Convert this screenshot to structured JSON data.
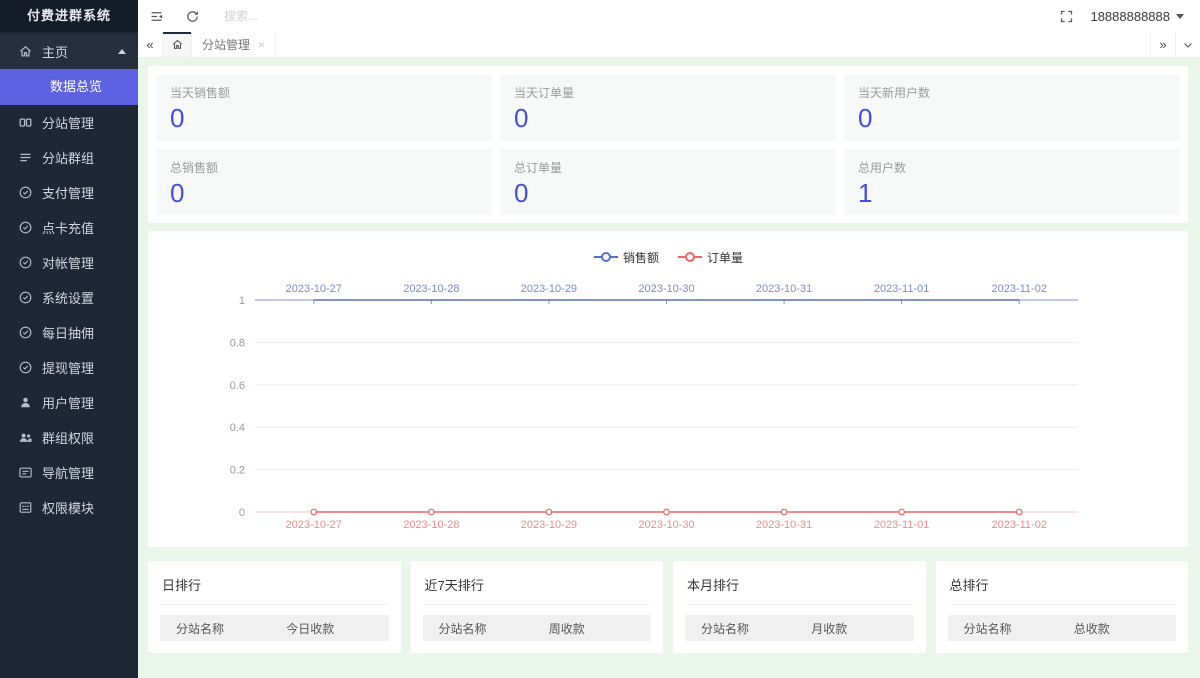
{
  "app": {
    "title": "付费进群系统",
    "user_phone": "18888888888"
  },
  "topbar": {
    "search_placeholder": "搜索..."
  },
  "tabs": {
    "items": [
      {
        "label": "分站管理"
      }
    ]
  },
  "sidebar": {
    "items": [
      {
        "label": "主页",
        "icon": "home-icon",
        "expanded": true,
        "children": [
          {
            "label": "数据总览",
            "active": true
          }
        ]
      },
      {
        "label": "分站管理",
        "icon": "component-icon"
      },
      {
        "label": "分站群组",
        "icon": "rows-icon"
      },
      {
        "label": "支付管理",
        "icon": "check-circle-icon"
      },
      {
        "label": "点卡充值",
        "icon": "check-circle-icon"
      },
      {
        "label": "对帐管理",
        "icon": "check-circle-icon"
      },
      {
        "label": "系统设置",
        "icon": "check-circle-icon"
      },
      {
        "label": "每日抽佣",
        "icon": "check-circle-icon"
      },
      {
        "label": "提现管理",
        "icon": "check-circle-icon"
      },
      {
        "label": "用户管理",
        "icon": "user-icon"
      },
      {
        "label": "群组权限",
        "icon": "users-icon"
      },
      {
        "label": "导航管理",
        "icon": "nav-icon"
      },
      {
        "label": "权限模块",
        "icon": "module-icon"
      }
    ]
  },
  "stats": {
    "cards": [
      {
        "label": "当天销售额",
        "value": "0"
      },
      {
        "label": "当天订单量",
        "value": "0"
      },
      {
        "label": "当天新用户数",
        "value": "0"
      },
      {
        "label": "总销售额",
        "value": "0"
      },
      {
        "label": "总订单量",
        "value": "0"
      },
      {
        "label": "总用户数",
        "value": "1"
      }
    ]
  },
  "chart_data": {
    "type": "line",
    "x": [
      "2023-10-27",
      "2023-10-28",
      "2023-10-29",
      "2023-10-30",
      "2023-10-31",
      "2023-11-01",
      "2023-11-02"
    ],
    "series": [
      {
        "name": "销售额",
        "color": "#5470c6",
        "values": [
          0,
          0,
          0,
          0,
          0,
          0,
          0
        ],
        "axis": "top",
        "symbol": "none"
      },
      {
        "name": "订单量",
        "color": "#ee6666",
        "values": [
          0,
          0,
          0,
          0,
          0,
          0,
          0
        ],
        "axis": "bottom",
        "symbol": "circle"
      }
    ],
    "yticks": [
      1,
      0.8,
      0.6,
      0.4,
      0.2,
      0
    ],
    "ylim": [
      0,
      1
    ],
    "legend_position": "top-center",
    "grid": true,
    "label_colors": {
      "top_axis": "#7b8bd5",
      "bottom_axis": "#ee8c8c",
      "ytick": "#999999"
    }
  },
  "rankings": [
    {
      "title": "日排行",
      "columns": [
        "分站名称",
        "今日收款"
      ]
    },
    {
      "title": "近7天排行",
      "columns": [
        "分站名称",
        "周收款"
      ]
    },
    {
      "title": "本月排行",
      "columns": [
        "分站名称",
        "月收款"
      ]
    },
    {
      "title": "总排行",
      "columns": [
        "分站名称",
        "总收款"
      ]
    }
  ]
}
